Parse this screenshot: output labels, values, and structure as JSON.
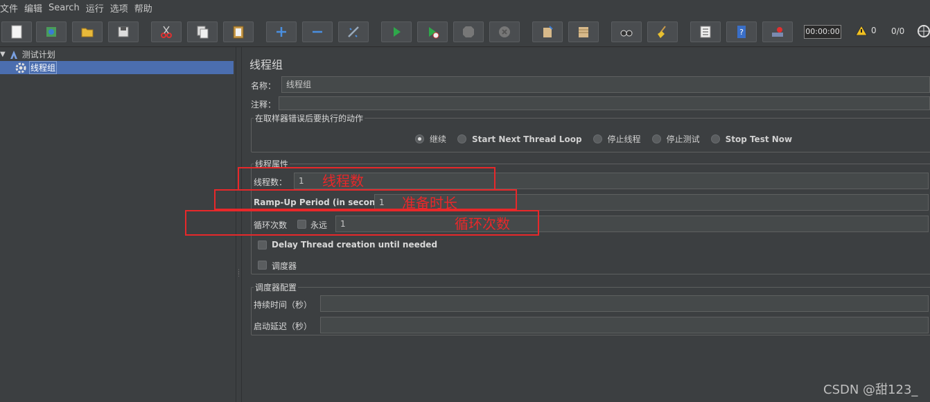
{
  "menu": [
    "文件",
    "编辑",
    "Search",
    "运行",
    "选项",
    "帮助"
  ],
  "toolbar": {
    "timer": "00:00:00",
    "warnings": "0",
    "threads": "0/0"
  },
  "tree": {
    "root_label": "测试计划",
    "child_label": "线程组"
  },
  "form": {
    "title": "线程组",
    "name_label": "名称：",
    "name_value": "线程组",
    "comment_label": "注释：",
    "comment_value": "",
    "error_group_title": "在取样器错误后要执行的动作",
    "error_actions": [
      {
        "label": "继续",
        "selected": true
      },
      {
        "label": "Start Next Thread Loop",
        "selected": false
      },
      {
        "label": "停止线程",
        "selected": false
      },
      {
        "label": "停止测试",
        "selected": false
      },
      {
        "label": "Stop Test Now",
        "selected": false
      }
    ],
    "thread_props_title": "线程属性",
    "threads_label": "线程数：",
    "threads_value": "1",
    "rampup_label": "Ramp-Up Period (in seconds):",
    "rampup_value": "1",
    "loop_label": "循环次数",
    "forever_label": "永远",
    "forever_checked": false,
    "loop_value": "1",
    "delay_label": "Delay Thread creation until needed",
    "delay_checked": false,
    "scheduler_label": "调度器",
    "scheduler_checked": false,
    "scheduler_config_title": "调度器配置",
    "duration_label": "持续时间（秒）",
    "duration_value": "",
    "startup_delay_label": "启动延迟（秒）",
    "startup_delay_value": ""
  },
  "annotations": {
    "threads": "线程数",
    "rampup": "准备时长",
    "loops": "循环次数",
    "color": "#e8282a"
  },
  "watermark": "CSDN @甜123_"
}
